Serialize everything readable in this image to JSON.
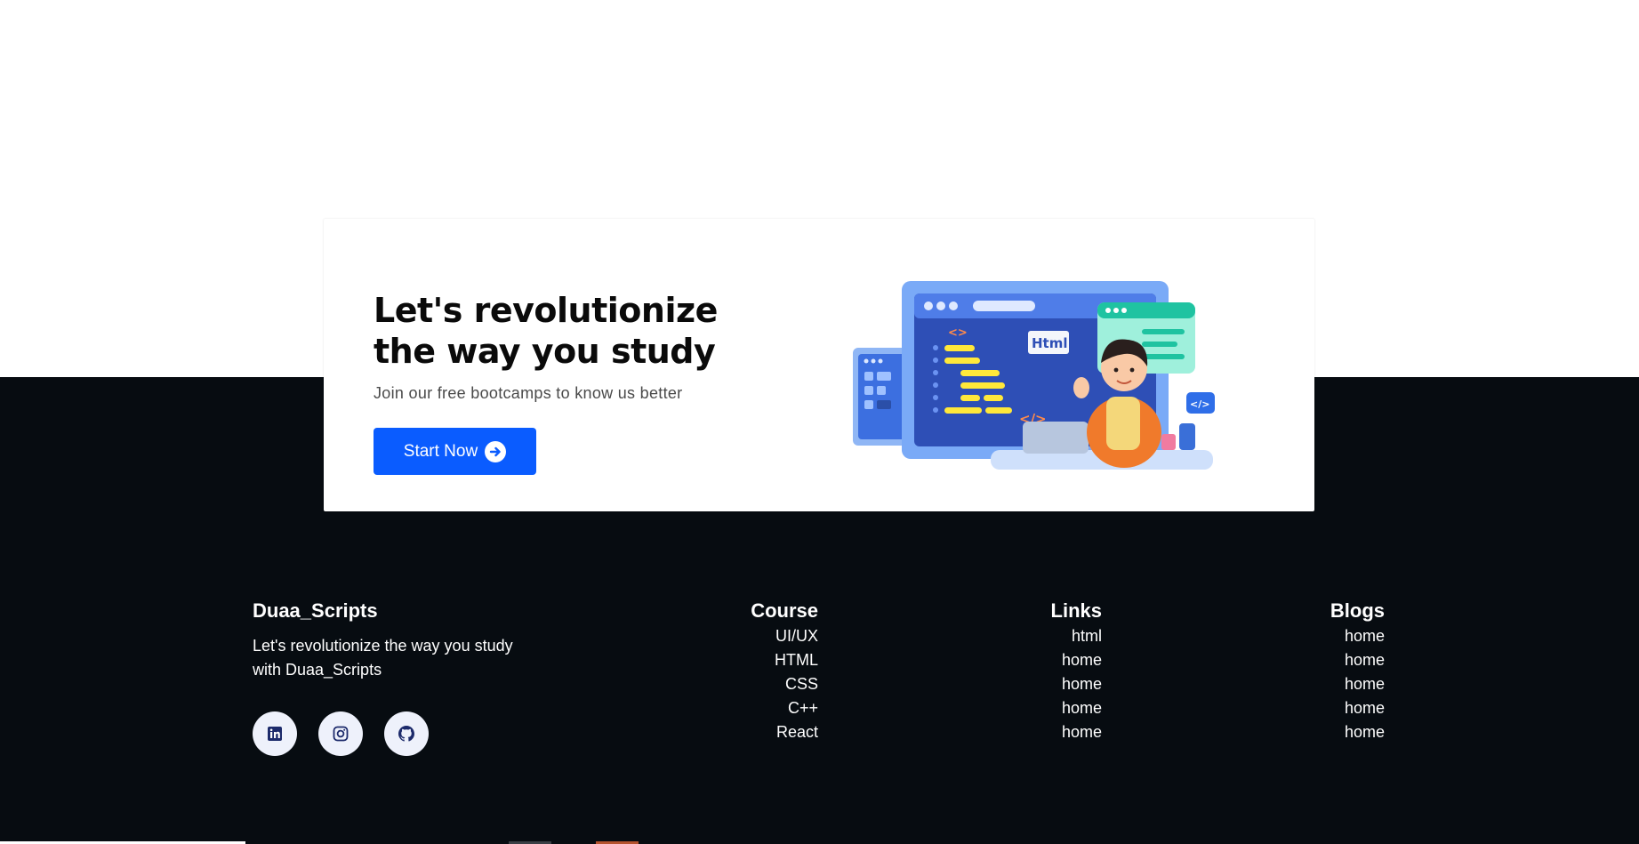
{
  "cta": {
    "title": "Let's revolutionize the way you study",
    "subtitle": "Join our free bootcamps to know us better",
    "button_label": "Start Now",
    "illustration": {
      "html_tag": "Html",
      "code_tag": "</>",
      "angle_tag": "<>"
    }
  },
  "footer": {
    "brand": "Duaa_Scripts",
    "description": "Let's revolutionize the way you study with Duaa_Scripts",
    "social": [
      "linkedin-icon",
      "instagram-icon",
      "github-icon"
    ],
    "columns": [
      {
        "heading": "Course",
        "links": [
          "UI/UX",
          "HTML",
          "CSS",
          "C++",
          "React"
        ]
      },
      {
        "heading": "Links",
        "links": [
          "html",
          "home",
          "home",
          "home",
          "home"
        ]
      },
      {
        "heading": "Blogs",
        "links": [
          "home",
          "home",
          "home",
          "home",
          "home"
        ]
      }
    ]
  },
  "colors": {
    "accent": "#0a5cff",
    "footer_bg": "#070c11"
  }
}
